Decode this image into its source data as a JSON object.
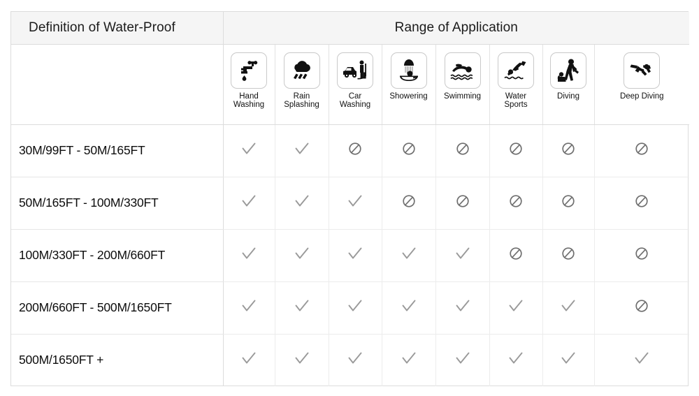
{
  "header": {
    "definition_title": "Definition of Water-Proof",
    "range_title": "Range of Application"
  },
  "columns": [
    {
      "label_line1": "Hand",
      "label_line2": "Washing",
      "icon": "faucet-handwashing-icon"
    },
    {
      "label_line1": "Rain",
      "label_line2": "Splashing",
      "icon": "rain-cloud-icon"
    },
    {
      "label_line1": "Car",
      "label_line2": "Washing",
      "icon": "car-washing-icon"
    },
    {
      "label_line1": "Showering",
      "label_line2": "",
      "icon": "showering-icon"
    },
    {
      "label_line1": "Swimming",
      "label_line2": "",
      "icon": "swimming-icon"
    },
    {
      "label_line1": "Water",
      "label_line2": "Sports",
      "icon": "water-sports-icon"
    },
    {
      "label_line1": "Diving",
      "label_line2": "",
      "icon": "diving-icon"
    },
    {
      "label_line1": "Deep Diving",
      "label_line2": "",
      "icon": "deep-diving-icon"
    }
  ],
  "rows": [
    {
      "label": "30M/99FT   -  50M/165FT",
      "marks": [
        "check",
        "check",
        "no",
        "no",
        "no",
        "no",
        "no",
        "no"
      ]
    },
    {
      "label": "50M/165FT   -  100M/330FT",
      "marks": [
        "check",
        "check",
        "check",
        "no",
        "no",
        "no",
        "no",
        "no"
      ]
    },
    {
      "label": "100M/330FT   -  200M/660FT",
      "marks": [
        "check",
        "check",
        "check",
        "check",
        "check",
        "no",
        "no",
        "no"
      ]
    },
    {
      "label": "200M/660FT   -  500M/1650FT",
      "marks": [
        "check",
        "check",
        "check",
        "check",
        "check",
        "check",
        "check",
        "no"
      ]
    },
    {
      "label": "500M/1650FT  +",
      "marks": [
        "check",
        "check",
        "check",
        "check",
        "check",
        "check",
        "check",
        "check"
      ]
    }
  ],
  "marks_legend": {
    "check": "supported-check-icon",
    "no": "not-supported-prohibited-icon"
  },
  "colors": {
    "banner_bg": "#f5f5f5",
    "border": "#dcdcdc",
    "text": "#111111",
    "check": "#9a9a9a",
    "no": "#6f6f6f"
  },
  "chart_data": {
    "type": "table",
    "title": "Definition of Water-Proof / Range of Application",
    "categories": [
      "Hand Washing",
      "Rain Splashing",
      "Car Washing",
      "Showering",
      "Swimming",
      "Water Sports",
      "Diving",
      "Deep Diving"
    ],
    "rows": [
      "30M/99FT   -  50M/165FT",
      "50M/165FT   -  100M/330FT",
      "100M/330FT   -  200M/660FT",
      "200M/660FT   -  500M/1650FT",
      "500M/1650FT  +"
    ],
    "values": [
      [
        1,
        1,
        0,
        0,
        0,
        0,
        0,
        0
      ],
      [
        1,
        1,
        1,
        0,
        0,
        0,
        0,
        0
      ],
      [
        1,
        1,
        1,
        1,
        1,
        0,
        0,
        0
      ],
      [
        1,
        1,
        1,
        1,
        1,
        1,
        1,
        0
      ],
      [
        1,
        1,
        1,
        1,
        1,
        1,
        1,
        1
      ]
    ],
    "legend": [
      "1 = check (supported)",
      "0 = prohibited (not supported)"
    ]
  }
}
